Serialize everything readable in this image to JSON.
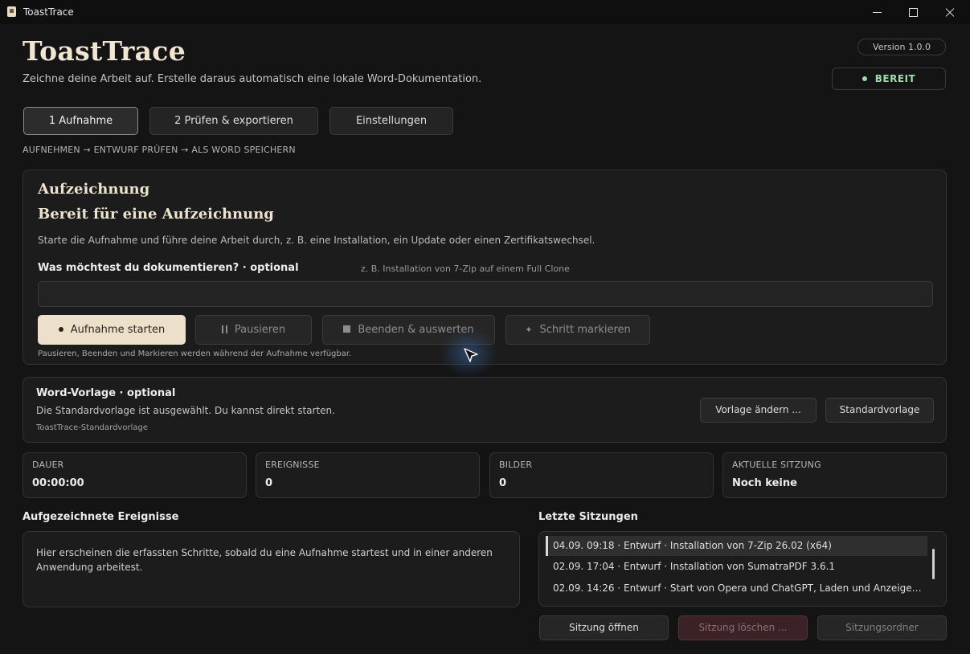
{
  "window": {
    "title": "ToastTrace"
  },
  "header": {
    "brand": "ToastTrace",
    "tagline": "Zeichne deine Arbeit auf. Erstelle daraus automatisch eine lokale Word-Dokumentation.",
    "version": "Version 1.0.0",
    "status": "BEREIT",
    "status_color": "#9fdcae"
  },
  "tabs": [
    {
      "label": "1  Aufnahme",
      "active": true
    },
    {
      "label": "2  Prüfen & exportieren",
      "active": false
    },
    {
      "label": "Einstellungen",
      "active": false
    }
  ],
  "steps": "AUFNEHMEN  →  ENTWURF PRÜFEN  →  ALS WORD SPEICHERN",
  "recording": {
    "section_title": "Aufzeichnung",
    "state_title": "Bereit für eine Aufzeichnung",
    "description": "Starte die Aufnahme und führe deine Arbeit durch, z. B. eine Installation, ein Update oder einen Zertifikatswechsel.",
    "doc_label": "Was möchtest du dokumentieren? · optional",
    "doc_hint": "z. B. Installation von 7-Zip auf einem Full Clone",
    "doc_value": "",
    "buttons": {
      "start": "Aufnahme starten",
      "pause": "Pausieren",
      "stop": "Beenden & auswerten",
      "mark": "Schritt markieren"
    },
    "note": "Pausieren, Beenden und Markieren werden während der Aufnahme verfügbar."
  },
  "template": {
    "title": "Word-Vorlage · optional",
    "description": "Die Standardvorlage ist ausgewählt. Du kannst direkt starten.",
    "name": "ToastTrace-Standardvorlage",
    "change_button": "Vorlage ändern ...",
    "default_button": "Standardvorlage"
  },
  "stats": [
    {
      "label": "DAUER",
      "value": "00:00:00"
    },
    {
      "label": "EREIGNISSE",
      "value": "0"
    },
    {
      "label": "BILDER",
      "value": "0"
    },
    {
      "label": "AKTUELLE SITZUNG",
      "value": "Noch keine"
    }
  ],
  "events": {
    "title": "Aufgezeichnete Ereignisse",
    "placeholder": "Hier erscheinen die erfassten Schritte, sobald du eine Aufnahme startest und in einer anderen Anwendung arbeitest."
  },
  "sessions": {
    "title": "Letzte Sitzungen",
    "items": [
      "04.09. 09:18 · Entwurf · Installation von 7-Zip 26.02 (x64)",
      "02.09. 17:04 · Entwurf · Installation von SumatraPDF 3.6.1",
      "02.09. 14:26 · Entwurf · Start von Opera und ChatGPT, Laden und Anzeige…"
    ],
    "selected_index": 0,
    "open_button": "Sitzung öffnen",
    "delete_button": "Sitzung löschen ...",
    "folder_button": "Sitzungsordner",
    "delete_color": "#3a2226"
  }
}
